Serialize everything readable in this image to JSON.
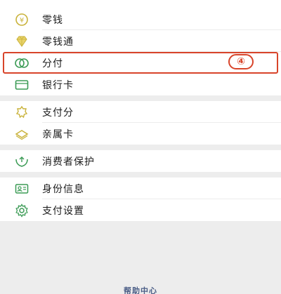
{
  "colors": {
    "background": "#ededed",
    "card": "#ffffff",
    "accent_green": "#3b9b55",
    "accent_yellow": "#c9b23a",
    "highlight_red": "#d8442a",
    "link_blue": "#4a5d86"
  },
  "groups": [
    {
      "items": [
        {
          "label": "零钱",
          "icon": "coin-icon"
        },
        {
          "label": "零钱通",
          "icon": "diamond-icon"
        },
        {
          "label": "分付",
          "icon": "ring-icon",
          "highlighted": true,
          "badge": "④"
        },
        {
          "label": "银行卡",
          "icon": "card-icon"
        }
      ]
    },
    {
      "items": [
        {
          "label": "支付分",
          "icon": "badge-icon"
        },
        {
          "label": "亲属卡",
          "icon": "family-card-icon"
        }
      ]
    },
    {
      "items": [
        {
          "label": "消费者保护",
          "icon": "shield-hands-icon"
        }
      ]
    },
    {
      "items": [
        {
          "label": "身份信息",
          "icon": "id-card-icon"
        },
        {
          "label": "支付设置",
          "icon": "gear-icon"
        }
      ]
    }
  ],
  "footer": {
    "help_label": "帮助中心"
  }
}
